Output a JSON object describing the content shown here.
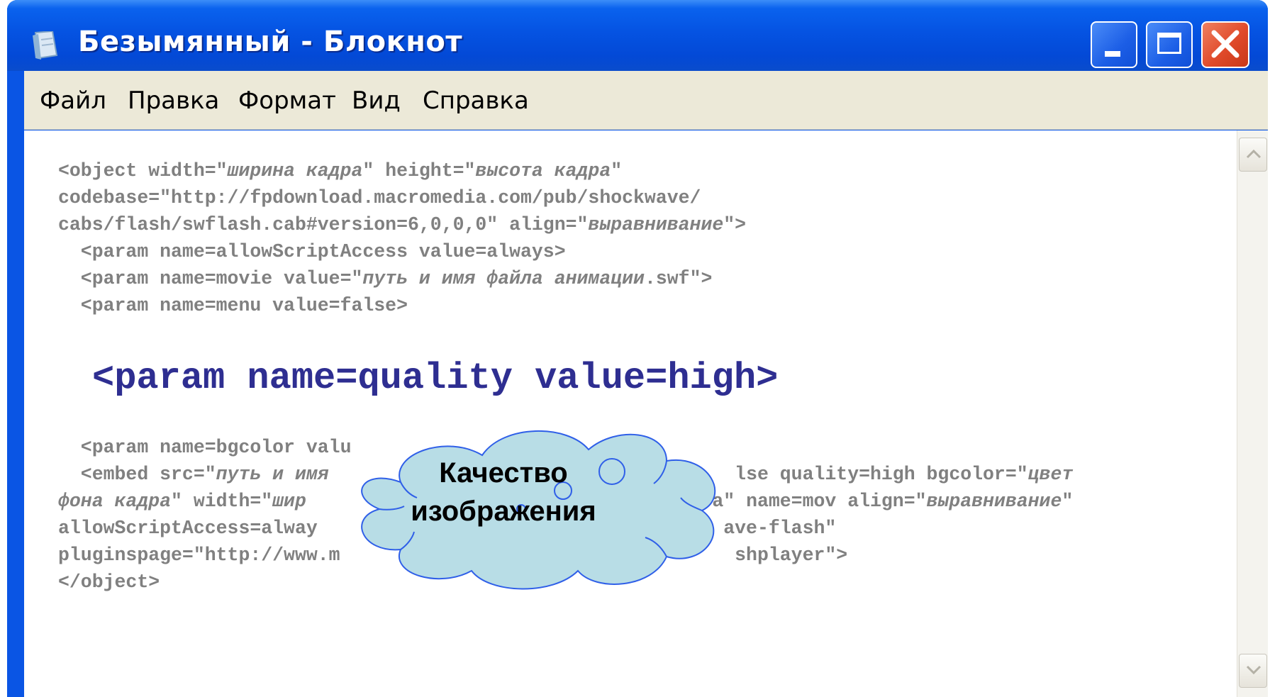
{
  "window": {
    "title": "Безымянный - Блокнот"
  },
  "menu": {
    "items": [
      "Файл",
      "Правка",
      "Формат",
      "Вид",
      "Справка"
    ]
  },
  "editor": {
    "code_before": [
      [
        "<object width=\"",
        {
          "i": "ширина кадра"
        },
        "\" height=\"",
        {
          "i": "высота кадра"
        },
        "\""
      ],
      [
        "codebase=\"http://fpdownload.macromedia.com/pub/shockwave/"
      ],
      [
        "cabs/flash/swflash.cab#version=6,0,0,0\" align=\"",
        {
          "i": "выравнивание"
        },
        "\">"
      ],
      [
        "  <param name=allowScriptAccess value=always>"
      ],
      [
        "  <param name=movie value=\"",
        {
          "i": "путь и имя файла анимации"
        },
        ".swf\">"
      ],
      [
        "  <param name=menu value=false>"
      ]
    ],
    "highlighted_line": "<param name=quality value=high>",
    "code_after": [
      [
        "  <param name=bgcolor valu"
      ],
      [
        "  <embed src=\"",
        {
          "i": "путь и имя"
        },
        "                                    lse quality=high bgcolor=\"",
        {
          "i": "цвет"
        }
      ],
      [
        {
          "i": "фона кадра"
        },
        "\" width=\"",
        {
          "i": "шир"
        },
        "                                    а\" name=mov align=\"",
        {
          "i": "выравнивание"
        },
        "\""
      ],
      [
        "allowScriptAccess=alway                                    ave-flash\""
      ],
      [
        "pluginspage=\"http://www.m                                   shplayer\">"
      ],
      [
        "</object>"
      ]
    ]
  },
  "callout": {
    "line1": "Качество",
    "line2": "изображения"
  },
  "colors": {
    "titlebar": "#0553e2",
    "menubar": "#ece9d8",
    "code_gray": "#808080",
    "highlight_blue": "#2e2e91",
    "cloud_fill": "#b8dde6",
    "cloud_stroke": "#2f5fe8"
  },
  "icons": [
    "notepad-icon",
    "minimize-icon",
    "maximize-icon",
    "close-icon",
    "scroll-up-icon",
    "scroll-down-icon"
  ]
}
